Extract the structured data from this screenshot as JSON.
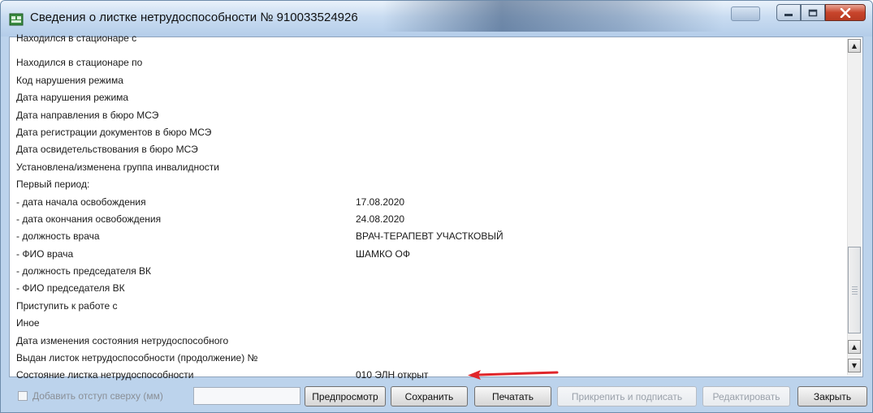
{
  "window": {
    "title": "Сведения о листке нетрудоспособности № 910033524926"
  },
  "rows": [
    {
      "label": "Находился в стационаре с",
      "value": ""
    },
    {
      "label": "Находился в стационаре по",
      "value": ""
    },
    {
      "label": "Код нарушения режима",
      "value": ""
    },
    {
      "label": "Дата нарушения режима",
      "value": ""
    },
    {
      "label": "Дата направления в бюро МСЭ",
      "value": ""
    },
    {
      "label": "Дата регистрации документов в бюро МСЭ",
      "value": ""
    },
    {
      "label": "Дата освидетельствования в бюро МСЭ",
      "value": ""
    },
    {
      "label": "Установлена/изменена группа инвалидности",
      "value": ""
    },
    {
      "label": "Первый период:",
      "value": ""
    },
    {
      "label": "- дата начала освобождения",
      "value": "17.08.2020"
    },
    {
      "label": "- дата окончания освобождения",
      "value": "24.08.2020"
    },
    {
      "label": "- должность врача",
      "value": "ВРАЧ-ТЕРАПЕВТ УЧАСТКОВЫЙ"
    },
    {
      "label": "- ФИО врача",
      "value": "ШАМКО ОФ"
    },
    {
      "label": "- должность председателя ВК",
      "value": ""
    },
    {
      "label": "- ФИО председателя ВК",
      "value": ""
    },
    {
      "label": "Приступить к работе с",
      "value": ""
    },
    {
      "label": "Иное",
      "value": ""
    },
    {
      "label": "Дата изменения состояния нетрудоспособного",
      "value": ""
    },
    {
      "label": "Выдан листок нетрудоспособности (продолжение) №",
      "value": ""
    },
    {
      "label": "Состояние листка нетрудоспособности",
      "value": "010 ЭЛН открыт"
    }
  ],
  "bottombar": {
    "indent_checkbox_label": "Добавить отступ сверху (мм)",
    "indent_input_value": "",
    "preview": "Предпросмотр",
    "save": "Сохранить",
    "print": "Печатать",
    "attach_sign": "Прикрепить и подписать",
    "edit": "Редактировать",
    "close": "Закрыть"
  },
  "colors": {
    "annotation_arrow": "#e0262b",
    "title_bar": "#c9dcf1",
    "close_button": "#c8442b"
  },
  "icons": {
    "app": "document-app-icon",
    "minimize": "minimize-icon",
    "maximize": "maximize-icon",
    "close": "close-icon",
    "scroll_up": "scroll-up-icon",
    "scroll_down": "scroll-down-icon"
  }
}
